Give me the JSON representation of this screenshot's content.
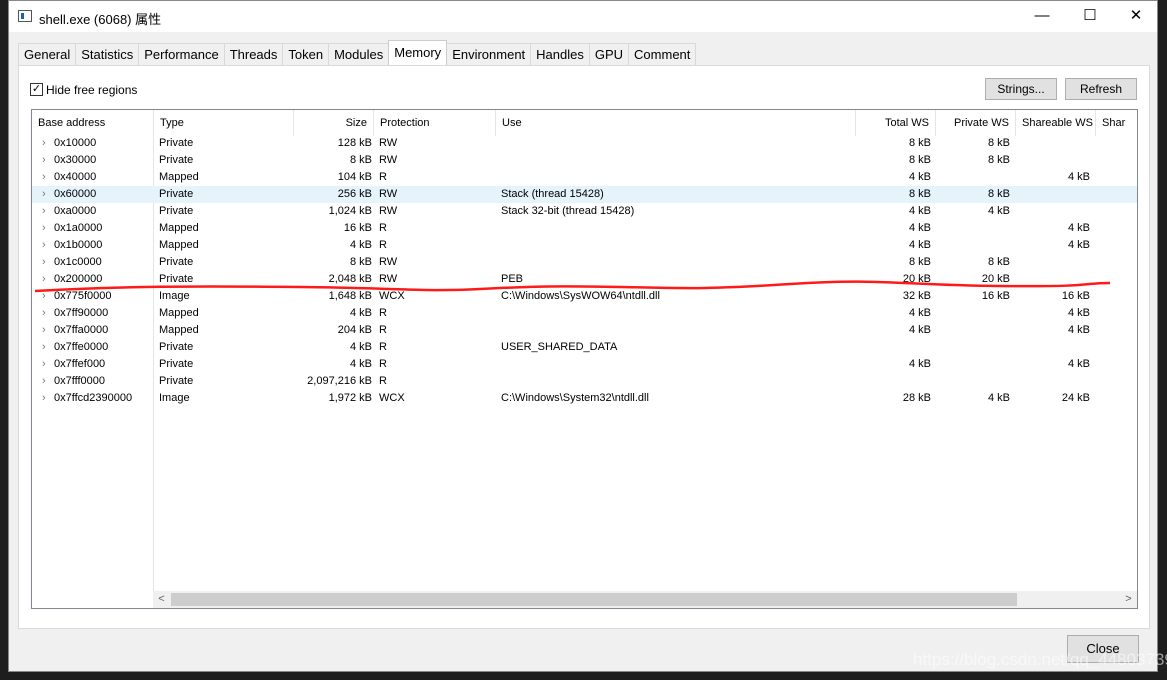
{
  "window": {
    "title": "shell.exe (6068) 属性",
    "minimize": "—",
    "maximize": "☐",
    "close": "✕"
  },
  "tabs": [
    "General",
    "Statistics",
    "Performance",
    "Threads",
    "Token",
    "Modules",
    "Memory",
    "Environment",
    "Handles",
    "GPU",
    "Comment"
  ],
  "active_tab": "Memory",
  "options": {
    "hide_free_regions": "Hide free regions",
    "hide_free_checked": true,
    "check_mark": "✓"
  },
  "buttons": {
    "strings": "Strings...",
    "refresh": "Refresh",
    "close": "Close"
  },
  "columns": [
    "Base address",
    "Type",
    "Size",
    "Protection",
    "Use",
    "Total WS",
    "Private WS",
    "Shareable WS",
    "Shar"
  ],
  "rows": [
    {
      "base": "0x10000",
      "type": "Private",
      "size": "128 kB",
      "prot": "RW",
      "use": "",
      "total": "8 kB",
      "private": "8 kB",
      "shareable": ""
    },
    {
      "base": "0x30000",
      "type": "Private",
      "size": "8 kB",
      "prot": "RW",
      "use": "",
      "total": "8 kB",
      "private": "8 kB",
      "shareable": ""
    },
    {
      "base": "0x40000",
      "type": "Mapped",
      "size": "104 kB",
      "prot": "R",
      "use": "",
      "total": "4 kB",
      "private": "",
      "shareable": "4 kB"
    },
    {
      "base": "0x60000",
      "type": "Private",
      "size": "256 kB",
      "prot": "RW",
      "use": "Stack (thread 15428)",
      "total": "8 kB",
      "private": "8 kB",
      "shareable": ""
    },
    {
      "base": "0xa0000",
      "type": "Private",
      "size": "1,024 kB",
      "prot": "RW",
      "use": "Stack 32-bit (thread 15428)",
      "total": "4 kB",
      "private": "4 kB",
      "shareable": ""
    },
    {
      "base": "0x1a0000",
      "type": "Mapped",
      "size": "16 kB",
      "prot": "R",
      "use": "",
      "total": "4 kB",
      "private": "",
      "shareable": "4 kB"
    },
    {
      "base": "0x1b0000",
      "type": "Mapped",
      "size": "4 kB",
      "prot": "R",
      "use": "",
      "total": "4 kB",
      "private": "",
      "shareable": "4 kB"
    },
    {
      "base": "0x1c0000",
      "type": "Private",
      "size": "8 kB",
      "prot": "RW",
      "use": "",
      "total": "8 kB",
      "private": "8 kB",
      "shareable": ""
    },
    {
      "base": "0x200000",
      "type": "Private",
      "size": "2,048 kB",
      "prot": "RW",
      "use": "PEB",
      "total": "20 kB",
      "private": "20 kB",
      "shareable": ""
    },
    {
      "base": "0x775f0000",
      "type": "Image",
      "size": "1,648 kB",
      "prot": "WCX",
      "use": "C:\\Windows\\SysWOW64\\ntdll.dll",
      "total": "32 kB",
      "private": "16 kB",
      "shareable": "16 kB"
    },
    {
      "base": "0x7ff90000",
      "type": "Mapped",
      "size": "4 kB",
      "prot": "R",
      "use": "",
      "total": "4 kB",
      "private": "",
      "shareable": "4 kB"
    },
    {
      "base": "0x7ffa0000",
      "type": "Mapped",
      "size": "204 kB",
      "prot": "R",
      "use": "",
      "total": "4 kB",
      "private": "",
      "shareable": "4 kB"
    },
    {
      "base": "0x7ffe0000",
      "type": "Private",
      "size": "4 kB",
      "prot": "R",
      "use": "USER_SHARED_DATA",
      "total": "",
      "private": "",
      "shareable": ""
    },
    {
      "base": "0x7ffef000",
      "type": "Private",
      "size": "4 kB",
      "prot": "R",
      "use": "",
      "total": "4 kB",
      "private": "",
      "shareable": "4 kB"
    },
    {
      "base": "0x7fff0000",
      "type": "Private",
      "size": "2,097,216 kB",
      "prot": "R",
      "use": "",
      "total": "",
      "private": "",
      "shareable": ""
    },
    {
      "base": "0x7ffcd2390000",
      "type": "Image",
      "size": "1,972 kB",
      "prot": "WCX",
      "use": "C:\\Windows\\System32\\ntdll.dll",
      "total": "28 kB",
      "private": "4 kB",
      "shareable": "24 kB"
    }
  ],
  "selected_row": 3,
  "annotation_color": "#ff1a1a",
  "watermark": "https://blog.csdn.net/qq_44803739"
}
